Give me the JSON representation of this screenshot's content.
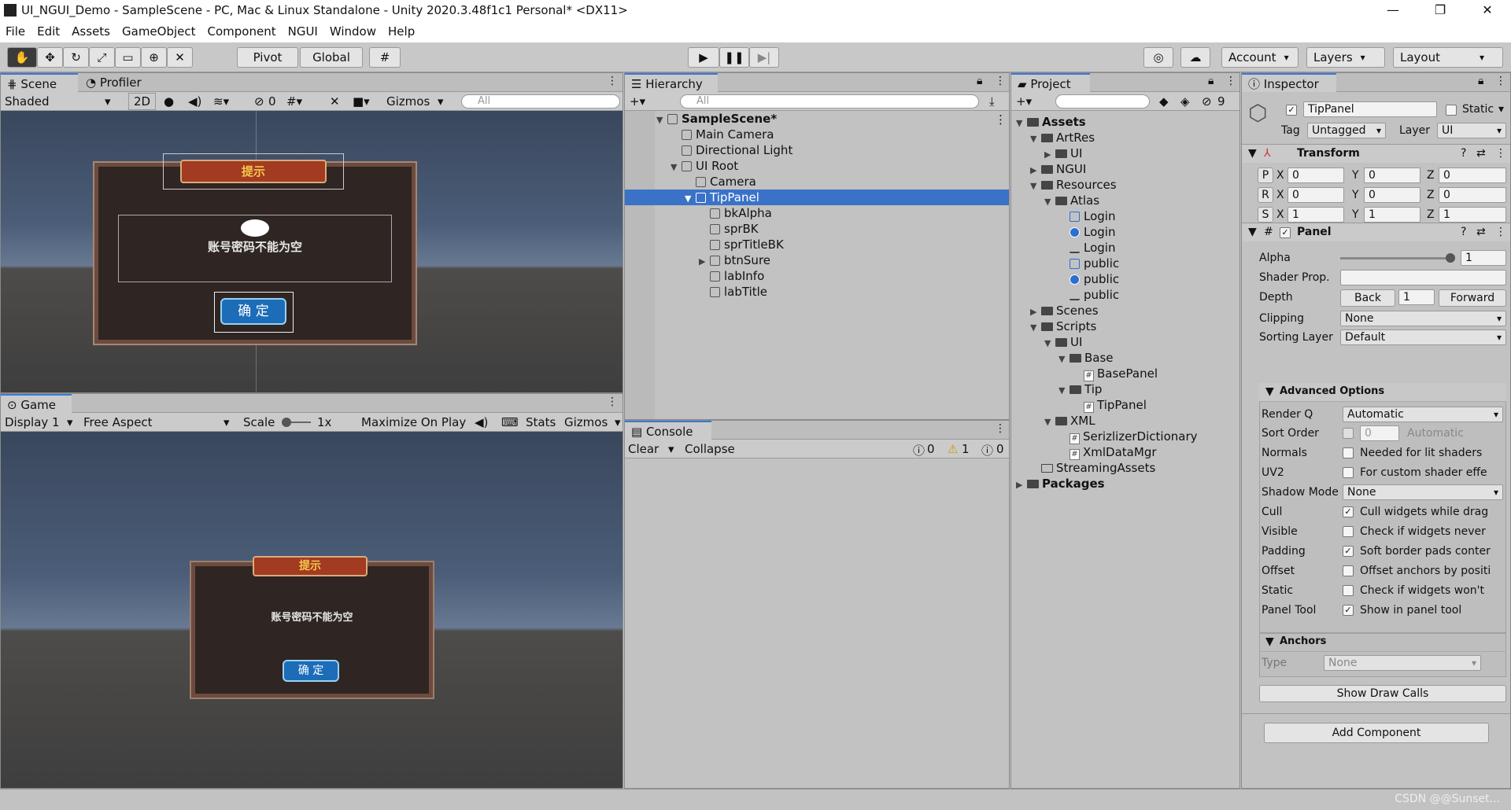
{
  "window": {
    "title": "UI_NGUI_Demo - SampleScene - PC, Mac & Linux Standalone - Unity 2020.3.48f1c1 Personal* <DX11>",
    "min": "—",
    "max": "❐",
    "close": "✕"
  },
  "menu": [
    "File",
    "Edit",
    "Assets",
    "GameObject",
    "Component",
    "NGUI",
    "Window",
    "Help"
  ],
  "toolbar": {
    "pivot": "Pivot",
    "global": "Global",
    "account": "Account",
    "layers": "Layers",
    "layout": "Layout"
  },
  "scene": {
    "tab_scene": "Scene",
    "tab_profiler": "Profiler",
    "shading": "Shaded",
    "mode2d": "2D",
    "hidden_count": "0",
    "gizmos": "Gizmos",
    "search_placeholder": "All",
    "dialog_title": "提示",
    "dialog_message": "账号密码不能为空",
    "dialog_button": "确 定"
  },
  "game": {
    "tab": "Game",
    "display": "Display 1",
    "aspect": "Free Aspect",
    "scale_label": "Scale",
    "scale_value": "1x",
    "maximize": "Maximize On Play",
    "stats": "Stats",
    "gizmos": "Gizmos",
    "dialog_title": "提示",
    "dialog_message": "账号密码不能为空",
    "dialog_button": "确 定"
  },
  "hierarchy": {
    "tab": "Hierarchy",
    "search_placeholder": "All",
    "items": [
      {
        "label": "SampleScene*",
        "bold": true,
        "depth": 0,
        "arrow": "▼",
        "icon": "scene"
      },
      {
        "label": "Main Camera",
        "depth": 1,
        "arrow": "",
        "icon": "cube"
      },
      {
        "label": "Directional Light",
        "depth": 1,
        "arrow": "",
        "icon": "cube"
      },
      {
        "label": "UI Root",
        "depth": 1,
        "arrow": "▼",
        "icon": "cube"
      },
      {
        "label": "Camera",
        "depth": 2,
        "arrow": "",
        "icon": "cube"
      },
      {
        "label": "TipPanel",
        "depth": 2,
        "arrow": "▼",
        "icon": "cube",
        "selected": true
      },
      {
        "label": "bkAlpha",
        "depth": 3,
        "arrow": "",
        "icon": "cube"
      },
      {
        "label": "sprBK",
        "depth": 3,
        "arrow": "",
        "icon": "cube"
      },
      {
        "label": "sprTitleBK",
        "depth": 3,
        "arrow": "",
        "icon": "cube"
      },
      {
        "label": "btnSure",
        "depth": 3,
        "arrow": "▶",
        "icon": "cube"
      },
      {
        "label": "labInfo",
        "depth": 3,
        "arrow": "",
        "icon": "cube"
      },
      {
        "label": "labTitle",
        "depth": 3,
        "arrow": "",
        "icon": "cube"
      }
    ]
  },
  "console": {
    "tab": "Console",
    "clear": "Clear",
    "collapse": "Collapse",
    "info_count": "0",
    "warn_count": "1",
    "error_count": "0"
  },
  "project": {
    "tab": "Project",
    "hidden_count": "9",
    "items": [
      {
        "label": "Assets",
        "depth": 0,
        "arrow": "▼",
        "icon": "folder",
        "bold": true
      },
      {
        "label": "ArtRes",
        "depth": 1,
        "arrow": "▼",
        "icon": "folder"
      },
      {
        "label": "UI",
        "depth": 2,
        "arrow": "▶",
        "icon": "folder"
      },
      {
        "label": "NGUI",
        "depth": 1,
        "arrow": "▶",
        "icon": "folder"
      },
      {
        "label": "Resources",
        "depth": 1,
        "arrow": "▼",
        "icon": "folder"
      },
      {
        "label": "Atlas",
        "depth": 2,
        "arrow": "▼",
        "icon": "folder"
      },
      {
        "label": "Login",
        "depth": 3,
        "arrow": "",
        "icon": "prefab"
      },
      {
        "label": "Login",
        "depth": 3,
        "arrow": "",
        "icon": "material"
      },
      {
        "label": "Login",
        "depth": 3,
        "arrow": "",
        "icon": "texture"
      },
      {
        "label": "public",
        "depth": 3,
        "arrow": "",
        "icon": "prefab"
      },
      {
        "label": "public",
        "depth": 3,
        "arrow": "",
        "icon": "material"
      },
      {
        "label": "public",
        "depth": 3,
        "arrow": "",
        "icon": "texture"
      },
      {
        "label": "Scenes",
        "depth": 1,
        "arrow": "▶",
        "icon": "folder"
      },
      {
        "label": "Scripts",
        "depth": 1,
        "arrow": "▼",
        "icon": "folder"
      },
      {
        "label": "UI",
        "depth": 2,
        "arrow": "▼",
        "icon": "folder"
      },
      {
        "label": "Base",
        "depth": 3,
        "arrow": "▼",
        "icon": "folder"
      },
      {
        "label": "BasePanel",
        "depth": 4,
        "arrow": "",
        "icon": "script"
      },
      {
        "label": "Tip",
        "depth": 3,
        "arrow": "▼",
        "icon": "folder"
      },
      {
        "label": "TipPanel",
        "depth": 4,
        "arrow": "",
        "icon": "script"
      },
      {
        "label": "XML",
        "depth": 2,
        "arrow": "▼",
        "icon": "folder"
      },
      {
        "label": "SerizlizerDictionary",
        "depth": 3,
        "arrow": "",
        "icon": "script"
      },
      {
        "label": "XmlDataMgr",
        "depth": 3,
        "arrow": "",
        "icon": "script"
      },
      {
        "label": "StreamingAssets",
        "depth": 1,
        "arrow": "",
        "icon": "folder-open"
      },
      {
        "label": "Packages",
        "depth": 0,
        "arrow": "▶",
        "icon": "folder",
        "bold": true
      }
    ]
  },
  "inspector": {
    "tab": "Inspector",
    "object_name": "TipPanel",
    "static_label": "Static",
    "tag_label": "Tag",
    "tag_value": "Untagged",
    "layer_label": "Layer",
    "layer_value": "UI",
    "transform": {
      "title": "Transform",
      "rows": [
        {
          "key": "P",
          "x": "0",
          "y": "0",
          "z": "0"
        },
        {
          "key": "R",
          "x": "0",
          "y": "0",
          "z": "0"
        },
        {
          "key": "S",
          "x": "1",
          "y": "1",
          "z": "1"
        }
      ]
    },
    "panel": {
      "title": "Panel",
      "alpha_label": "Alpha",
      "alpha_value": "1",
      "alpha_fraction": 1,
      "shader_label": "Shader Prop.",
      "depth_label": "Depth",
      "depth_back": "Back",
      "depth_value": "1",
      "depth_forward": "Forward",
      "clipping_label": "Clipping",
      "clipping_value": "None",
      "sorting_label": "Sorting Layer",
      "sorting_value": "Default"
    },
    "advanced": {
      "title": "Advanced Options",
      "renderq_label": "Render Q",
      "renderq_value": "Automatic",
      "sortorder_label": "Sort Order",
      "sortorder_value": "0",
      "sortorder_hint": "Automatic",
      "shadow_label": "Shadow Mode",
      "shadow_value": "None",
      "options": [
        {
          "label": "Normals",
          "checked": false,
          "desc": "Needed for lit shaders"
        },
        {
          "label": "UV2",
          "checked": false,
          "desc": "For custom shader effe"
        },
        {
          "label": "Cull",
          "checked": true,
          "desc": "Cull widgets while drag"
        },
        {
          "label": "Visible",
          "checked": false,
          "desc": "Check if widgets never"
        },
        {
          "label": "Padding",
          "checked": true,
          "desc": "Soft border pads conter"
        },
        {
          "label": "Offset",
          "checked": false,
          "desc": "Offset anchors by positi"
        },
        {
          "label": "Static",
          "checked": false,
          "desc": "Check if widgets won't"
        },
        {
          "label": "Panel Tool",
          "checked": true,
          "desc": "Show in panel tool"
        }
      ]
    },
    "anchors": {
      "title": "Anchors",
      "type_label": "Type",
      "type_value": "None"
    },
    "show_draw_calls": "Show Draw Calls",
    "add_component": "Add Component"
  },
  "watermark": "CSDN @@Sunset..."
}
